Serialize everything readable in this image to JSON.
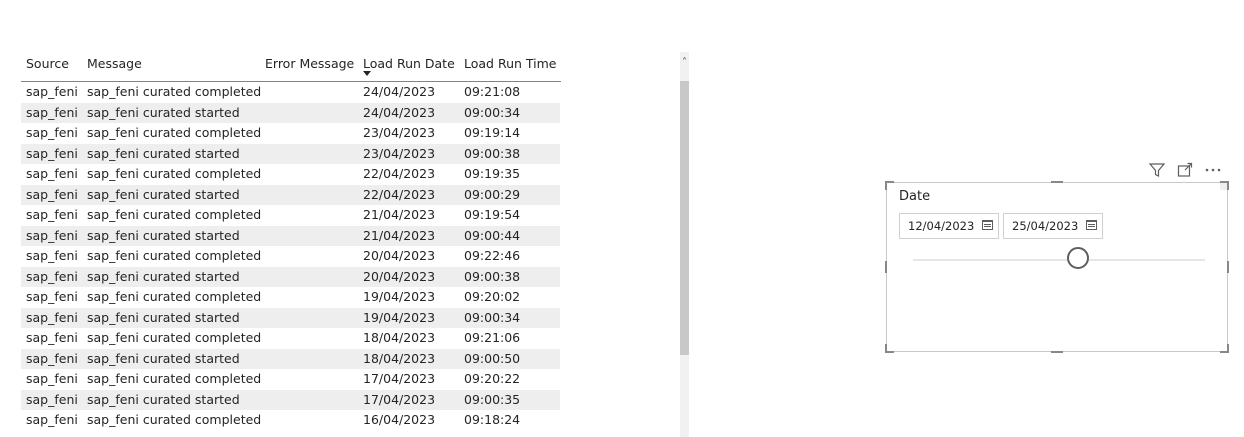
{
  "table": {
    "columns": [
      "Source",
      "Message",
      "Error Message",
      "Load Run Date",
      "Load Run Time"
    ],
    "sorted_column": "Load Run Date",
    "rows": [
      [
        "sap_feni",
        "sap_feni curated completed",
        "",
        "24/04/2023",
        "09:21:08"
      ],
      [
        "sap_feni",
        "sap_feni curated started",
        "",
        "24/04/2023",
        "09:00:34"
      ],
      [
        "sap_feni",
        "sap_feni curated completed",
        "",
        "23/04/2023",
        "09:19:14"
      ],
      [
        "sap_feni",
        "sap_feni curated started",
        "",
        "23/04/2023",
        "09:00:38"
      ],
      [
        "sap_feni",
        "sap_feni curated completed",
        "",
        "22/04/2023",
        "09:19:35"
      ],
      [
        "sap_feni",
        "sap_feni curated started",
        "",
        "22/04/2023",
        "09:00:29"
      ],
      [
        "sap_feni",
        "sap_feni curated completed",
        "",
        "21/04/2023",
        "09:19:54"
      ],
      [
        "sap_feni",
        "sap_feni curated started",
        "",
        "21/04/2023",
        "09:00:44"
      ],
      [
        "sap_feni",
        "sap_feni curated completed",
        "",
        "20/04/2023",
        "09:22:46"
      ],
      [
        "sap_feni",
        "sap_feni curated started",
        "",
        "20/04/2023",
        "09:00:38"
      ],
      [
        "sap_feni",
        "sap_feni curated completed",
        "",
        "19/04/2023",
        "09:20:02"
      ],
      [
        "sap_feni",
        "sap_feni curated started",
        "",
        "19/04/2023",
        "09:00:34"
      ],
      [
        "sap_feni",
        "sap_feni curated completed",
        "",
        "18/04/2023",
        "09:21:06"
      ],
      [
        "sap_feni",
        "sap_feni curated started",
        "",
        "18/04/2023",
        "09:00:50"
      ],
      [
        "sap_feni",
        "sap_feni curated completed",
        "",
        "17/04/2023",
        "09:20:22"
      ],
      [
        "sap_feni",
        "sap_feni curated started",
        "",
        "17/04/2023",
        "09:00:35"
      ],
      [
        "sap_feni",
        "sap_feni curated completed",
        "",
        "16/04/2023",
        "09:18:24"
      ]
    ]
  },
  "slicer": {
    "title": "Date",
    "start_date": "12/04/2023",
    "end_date": "25/04/2023",
    "toolbar_icons": [
      "filter-icon",
      "focus-mode-icon",
      "more-options-icon"
    ]
  },
  "colors": {
    "header_underline": "#2a9fd8",
    "alt_row": "#eeeeee",
    "scroll_thumb": "#c8c8c8"
  }
}
